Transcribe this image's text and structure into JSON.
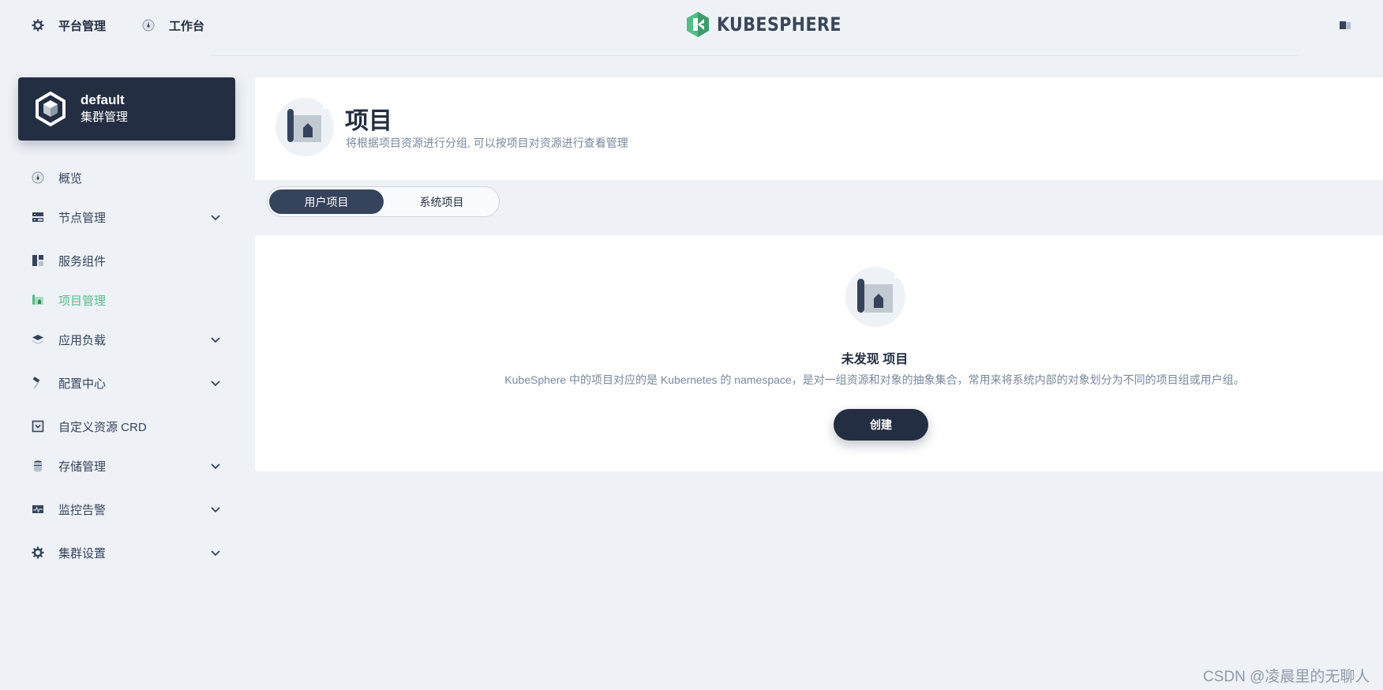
{
  "topnav": {
    "platform_label": "平台管理",
    "workbench_label": "工作台",
    "logo_text": "KUBESPHERE"
  },
  "cluster": {
    "name": "default",
    "subtitle": "集群管理"
  },
  "sidebar": {
    "items": [
      {
        "label": "概览",
        "icon": "dashboard-icon"
      },
      {
        "label": "节点管理",
        "icon": "nodes-icon",
        "expandable": true
      },
      {
        "label": "服务组件",
        "icon": "components-icon"
      },
      {
        "label": "项目管理",
        "icon": "project-icon",
        "active": true
      },
      {
        "label": "应用负载",
        "icon": "workloads-icon",
        "expandable": true
      },
      {
        "label": "配置中心",
        "icon": "hammer-icon",
        "expandable": true
      },
      {
        "label": "自定义资源 CRD",
        "icon": "crd-icon"
      },
      {
        "label": "存储管理",
        "icon": "storage-icon",
        "expandable": true
      },
      {
        "label": "监控告警",
        "icon": "monitoring-icon",
        "expandable": true
      },
      {
        "label": "集群设置",
        "icon": "gear-icon",
        "expandable": true
      }
    ]
  },
  "page": {
    "title": "项目",
    "description": "将根据项目资源进行分组, 可以按项目对资源进行查看管理"
  },
  "tabs": {
    "user_projects": "用户项目",
    "system_projects": "系统项目",
    "active": "用户项目"
  },
  "empty_state": {
    "title": "未发现 项目",
    "description": "KubeSphere 中的项目对应的是 Kubernetes 的 namespace，是对一组资源和对象的抽象集合，常用来将系统内部的对象划分为不同的项目组或用户组。",
    "create_label": "创建"
  },
  "watermark": "CSDN @凌晨里的无聊人",
  "colors": {
    "primary_dark": "#242e42",
    "accent_green": "#55bc8a",
    "background": "#eef2f6"
  }
}
